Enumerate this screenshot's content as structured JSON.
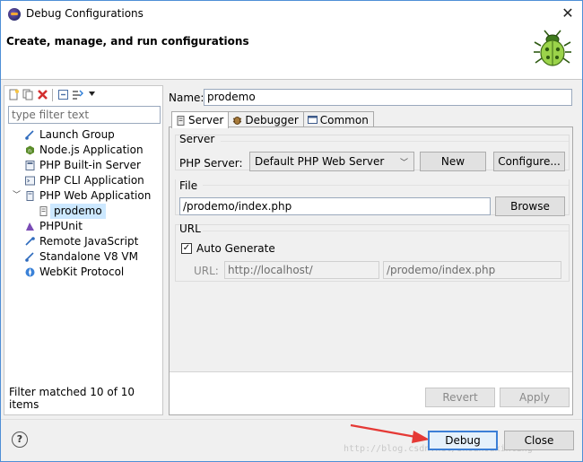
{
  "window": {
    "title": "Debug Configurations",
    "close_glyph": "✕",
    "heading": "Create, manage, and run configurations"
  },
  "left_panel": {
    "toolbar_icons": [
      "new-config-icon",
      "duplicate-icon",
      "delete-icon",
      "collapse-all-icon",
      "filter-icon",
      "dropdown-icon"
    ],
    "filter_placeholder": "type filter text",
    "tree": [
      {
        "label": "Launch Group",
        "icon": "launch-group-icon",
        "level": 0
      },
      {
        "label": "Node.js Application",
        "icon": "nodejs-icon",
        "level": 0
      },
      {
        "label": "PHP Built-in Server",
        "icon": "php-server-icon",
        "level": 0
      },
      {
        "label": "PHP CLI Application",
        "icon": "php-cli-icon",
        "level": 0
      },
      {
        "label": "PHP Web Application",
        "icon": "php-web-icon",
        "level": 0,
        "expanded": true
      },
      {
        "label": "prodemo",
        "icon": "php-config-icon",
        "level": 1,
        "selected": true
      },
      {
        "label": "PHPUnit",
        "icon": "phpunit-icon",
        "level": 0
      },
      {
        "label": "Remote JavaScript",
        "icon": "remote-js-icon",
        "level": 0
      },
      {
        "label": "Standalone V8 VM",
        "icon": "v8-icon",
        "level": 0
      },
      {
        "label": "WebKit Protocol",
        "icon": "webkit-icon",
        "level": 0
      }
    ],
    "status": "Filter matched 10 of 10 items"
  },
  "config": {
    "name_label": "Name:",
    "name_value": "prodemo",
    "tabs": [
      {
        "label": "Server",
        "icon": "server-icon",
        "active": true
      },
      {
        "label": "Debugger",
        "icon": "debugger-icon",
        "active": false
      },
      {
        "label": "Common",
        "icon": "common-icon",
        "active": false
      }
    ],
    "server_group": {
      "title": "Server",
      "label": "PHP Server:",
      "selected": "Default PHP Web Server",
      "new_button": "New",
      "configure_button": "Configure..."
    },
    "file_group": {
      "title": "File",
      "value": "/prodemo/index.php",
      "browse_button": "Browse"
    },
    "url_group": {
      "title": "URL",
      "auto_generate_label": "Auto Generate",
      "auto_generate_checked": true,
      "url_label": "URL:",
      "url_base": "http://localhost/",
      "url_path": "/prodemo/index.php"
    },
    "revert_button": "Revert",
    "apply_button": "Apply"
  },
  "footer": {
    "help_glyph": "?",
    "debug_button": "Debug",
    "close_button": "Close",
    "watermark": "http://blog.csdn.net/shouhouxinling"
  },
  "colors": {
    "accent": "#3c7fd6",
    "selection": "#cce8ff",
    "arrow": "#e53935"
  }
}
